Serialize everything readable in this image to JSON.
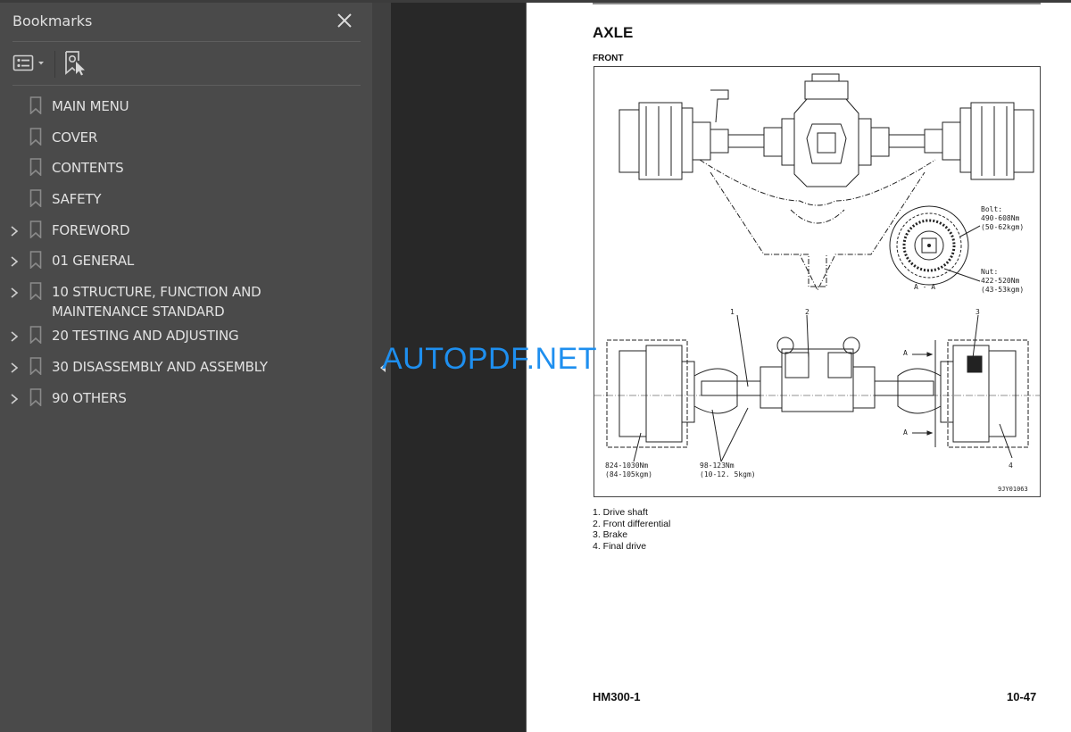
{
  "bookmarks_panel": {
    "title": "Bookmarks",
    "close_icon": "close-icon",
    "toolbar": {
      "options_icon": "list-options-icon",
      "find_icon": "find-current-bookmark-icon"
    },
    "items": [
      {
        "label": "MAIN MENU",
        "expandable": false
      },
      {
        "label": "COVER",
        "expandable": false
      },
      {
        "label": "CONTENTS",
        "expandable": false
      },
      {
        "label": "SAFETY",
        "expandable": false
      },
      {
        "label": "FOREWORD",
        "expandable": true
      },
      {
        "label": "01 GENERAL",
        "expandable": true
      },
      {
        "label": "10 STRUCTURE, FUNCTION AND MAINTENANCE STANDARD",
        "expandable": true
      },
      {
        "label": "20 TESTING AND ADJUSTING",
        "expandable": true
      },
      {
        "label": "30 DISASSEMBLY AND ASSEMBLY",
        "expandable": true
      },
      {
        "label": "90 OTHERS",
        "expandable": true
      }
    ]
  },
  "document_page": {
    "title": "AXLE",
    "subtitle": "FRONT",
    "figure": {
      "section_label": "A - A",
      "bolt_label": "Bolt:",
      "bolt_torque": "490-608Nm",
      "bolt_torque_kgm": "(50-62kgm)",
      "nut_label": "Nut:",
      "nut_torque": "422-520Nm",
      "nut_torque_kgm": "(43-53kgm)",
      "callouts": [
        "1",
        "2",
        "3",
        "4"
      ],
      "section_marker": "A",
      "torque_left": "824-1030Nm",
      "torque_left_kgm": "(84-105kgm)",
      "torque_mid": "98-123Nm",
      "torque_mid_kgm": "(10-12. 5kgm)",
      "figure_id": "9JY01063"
    },
    "legend": [
      "1. Drive shaft",
      "2. Front differential",
      "3. Brake",
      "4. Final drive"
    ],
    "footer_model": "HM300-1",
    "footer_page": "10-47"
  },
  "watermark": "AUTOPDF.NET",
  "colors": {
    "panel_bg": "#4a4a4a",
    "viewer_bg": "#282828",
    "watermark": "#1e8fef"
  }
}
